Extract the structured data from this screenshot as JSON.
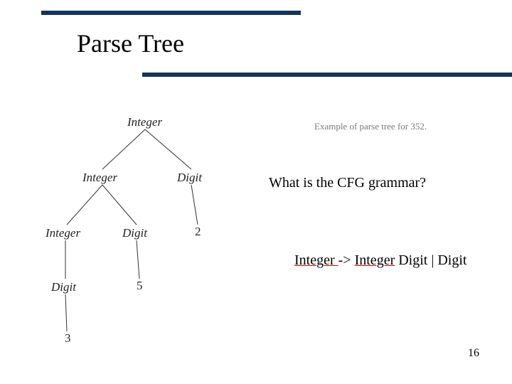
{
  "title": "Parse Tree",
  "caption": "Example of parse tree for 352.",
  "question": "What is the CFG grammar?",
  "grammar": {
    "lhs": "Integer ",
    "arrow": "-> ",
    "rhs1": "Integer",
    "rhs2": " Digit |  Digit"
  },
  "tree": {
    "root": "Integer",
    "l1_int": "Integer",
    "l1_dig": "Digit",
    "l2_int": "Integer",
    "l2_dig": "Digit",
    "l2_leaf2": "2",
    "l3_dig": "Digit",
    "l3_leaf5": "5",
    "l4_leaf3": "3"
  },
  "page_number": "16"
}
